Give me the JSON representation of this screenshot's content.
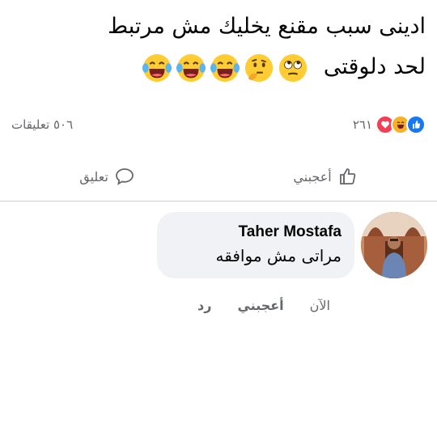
{
  "post": {
    "line1": "ادينى سبب مقنع يخليك مش مرتبط",
    "line2": "لحد دلوقتى",
    "emojis": [
      "rolling-eyes-icon",
      "thinking-face-icon",
      "laughing-tears-icon",
      "laughing-tears-icon",
      "laughing-tears-icon"
    ]
  },
  "stats": {
    "reactions_count": "٢٦١",
    "comments_count": "٥٠٦ تعليقات",
    "reaction_icons": [
      "like-reaction-icon",
      "haha-reaction-icon",
      "love-reaction-icon"
    ]
  },
  "actions": {
    "like_label": "أعجبني",
    "comment_label": "تعليق"
  },
  "comment": {
    "author": "Taher Mostafa",
    "text": "مراتى مش موافقه",
    "time": "الآن",
    "like_label": "أعجبني",
    "reply_label": "رد"
  },
  "colors": {
    "like_blue": "#1877f2",
    "love_red": "#f33e58",
    "haha_yellow": "#f7b125",
    "secondary_text": "#65676b",
    "bubble_bg": "#f0f2f5"
  }
}
